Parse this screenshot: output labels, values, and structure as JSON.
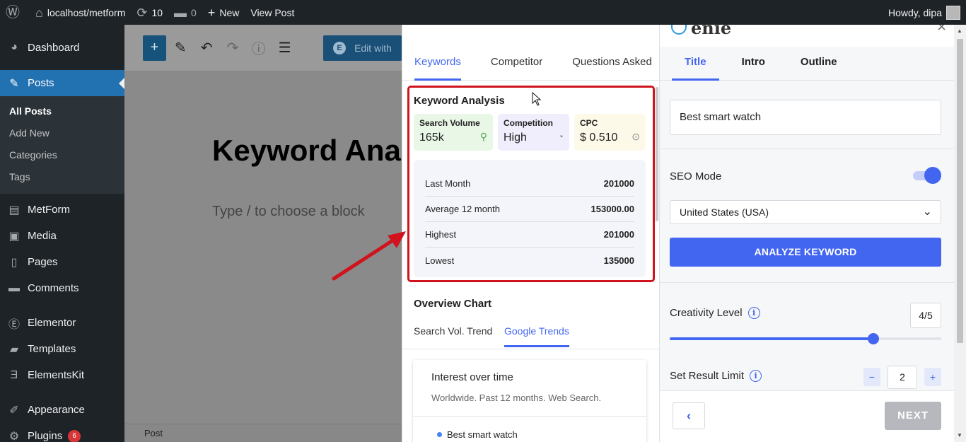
{
  "adminbar": {
    "site": "localhost/metform",
    "updates_count": "10",
    "comments_count": "0",
    "new_label": "New",
    "view_post": "View Post",
    "howdy": "Howdy, dipa"
  },
  "sidebar": {
    "dashboard": "Dashboard",
    "posts": "Posts",
    "sub": [
      "All Posts",
      "Add New",
      "Categories",
      "Tags"
    ],
    "items": [
      "MetForm",
      "Media",
      "Pages",
      "Comments",
      "Elementor",
      "Templates",
      "ElementsKit",
      "Appearance",
      "Plugins"
    ],
    "plugins_badge": "6"
  },
  "editor": {
    "edit_with": "Edit with",
    "post_title": "Keyword Analy",
    "block_hint": "Type / to choose a block",
    "footer": "Post"
  },
  "keywords_panel": {
    "tabs": [
      "Keywords",
      "Competitor",
      "Questions Asked"
    ],
    "analysis_title": "Keyword Analysis",
    "metrics": {
      "search_volume_label": "Search Volume",
      "search_volume": "165k",
      "competition_label": "Competition",
      "competition": "High",
      "cpc_label": "CPC",
      "cpc": "$ 0.510"
    },
    "stats": [
      {
        "label": "Last Month",
        "value": "201000"
      },
      {
        "label": "Average 12 month",
        "value": "153000.00"
      },
      {
        "label": "Highest",
        "value": "201000"
      },
      {
        "label": "Lowest",
        "value": "135000"
      }
    ],
    "overview_title": "Overview Chart",
    "overview_tabs": [
      "Search Vol. Trend",
      "Google Trends"
    ],
    "trends_card": {
      "title": "Interest over time",
      "subtitle": "Worldwide. Past 12 months. Web Search.",
      "legend": "Best smart watch"
    }
  },
  "genie": {
    "logo_text": "enie",
    "tabs": [
      "Title",
      "Intro",
      "Outline"
    ],
    "title_value": "Best smart watch",
    "seo_mode_label": "SEO Mode",
    "seo_mode_on": true,
    "country": "United States (USA)",
    "analyze_button": "ANALYZE KEYWORD",
    "creativity_label": "Creativity Level",
    "creativity_value": "4/5",
    "creativity_fraction": 0.75,
    "result_limit_label": "Set Result Limit",
    "result_limit": "2",
    "minus": "−",
    "plus": "+",
    "next_button": "NEXT"
  },
  "colors": {
    "accent": "#4266f0",
    "highlight_box": "#d0131d",
    "wp_blue": "#2271b1",
    "admin_dark": "#1d2327"
  }
}
